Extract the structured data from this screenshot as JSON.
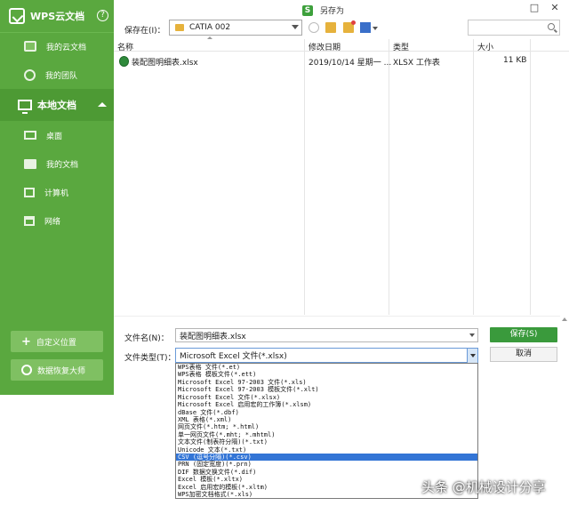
{
  "sidebar": {
    "app_title": "WPS云文档",
    "help": "?",
    "cloud_items": [
      {
        "label": "我的云文档",
        "icon": "cloud-doc-icon"
      },
      {
        "label": "我的团队",
        "icon": "team-icon"
      }
    ],
    "local_title": "本地文档",
    "local_items": [
      {
        "label": "桌面",
        "icon": "desktop-icon"
      },
      {
        "label": "我的文档",
        "icon": "folder-icon"
      },
      {
        "label": "计算机",
        "icon": "computer-icon"
      },
      {
        "label": "网络",
        "icon": "network-icon"
      }
    ],
    "custom_location": "自定义位置",
    "plus": "+",
    "data_recovery": "数据恢复大师"
  },
  "window": {
    "title": "另存为",
    "title_icon": "S",
    "minimize": "□",
    "close": "✕"
  },
  "toolbar": {
    "save_in_label": "保存在(I)：",
    "path_value": "CATIA 002"
  },
  "file_list": {
    "columns": [
      "名称",
      "修改日期",
      "类型",
      "大小"
    ],
    "rows": [
      {
        "name": "装配图明细表.xlsx",
        "date": "2019/10/14 星期一 ...",
        "type": "XLSX 工作表",
        "size": "11 KB"
      }
    ]
  },
  "form": {
    "filename_label": "文件名(N)：",
    "filename_value": "装配图明细表.xlsx",
    "filetype_label": "文件类型(T)：",
    "filetype_value": "Microsoft Excel 文件(*.xlsx)",
    "save_button": "保存(S)",
    "cancel_button": "取消"
  },
  "filetype_options": [
    "WPS表格 文件(*.et)",
    "WPS表格 模板文件(*.ett)",
    "Microsoft Excel 97-2003 文件(*.xls)",
    "Microsoft Excel 97-2003 模板文件(*.xlt)",
    "Microsoft Excel 文件(*.xlsx)",
    "Microsoft Excel 启用宏的工作簿(*.xlsm)",
    "dBase 文件(*.dbf)",
    "XML 表格(*.xml)",
    "网页文件(*.htm; *.html)",
    "单一网页文件(*.mht; *.mhtml)",
    "文本文件(制表符分隔)(*.txt)",
    "Unicode 文本(*.txt)",
    "CSV (逗号分隔)(*.csv)",
    "PRN (固定宽度)(*.prn)",
    "DIF 数据交换文件(*.dif)",
    "Excel 模板(*.xltx)",
    "Excel 启用宏的模板(*.xltm)",
    "WPS加密文档格式(*.xls)"
  ],
  "selected_option_index": 12,
  "watermark": "头条 @机械设计分享"
}
